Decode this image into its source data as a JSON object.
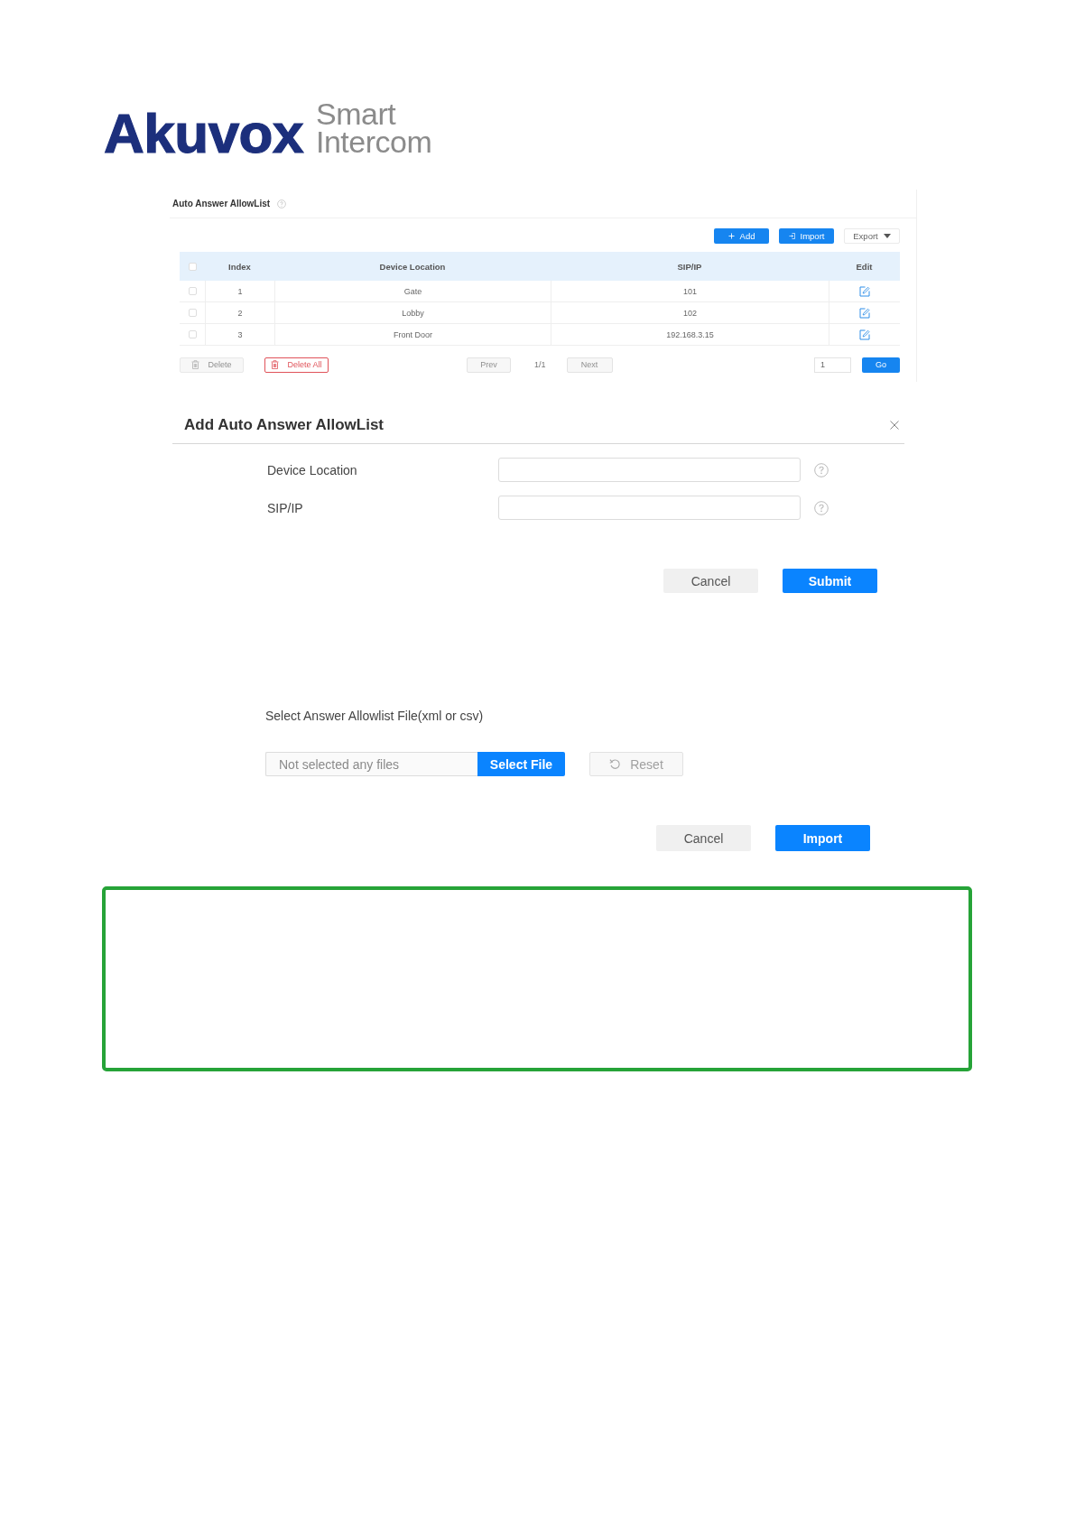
{
  "logo": {
    "brand": "Akuvox",
    "tagline": [
      "Smart",
      "Intercom"
    ]
  },
  "allowlist": {
    "title": "Auto Answer AllowList",
    "actions": [
      {
        "kind": "add",
        "label": "Add"
      },
      {
        "kind": "import",
        "label": "Import"
      },
      {
        "kind": "export",
        "label": "Export"
      }
    ],
    "table": {
      "select_all": {
        "checked": false
      },
      "columns": [
        "Index",
        "Device Location",
        "SIP/IP",
        "Edit"
      ],
      "rows": [
        {
          "checked": false,
          "index": "1",
          "device_location": "Gate",
          "sip_ip": "101"
        },
        {
          "checked": false,
          "index": "2",
          "device_location": "Lobby",
          "sip_ip": "102"
        },
        {
          "checked": false,
          "index": "3",
          "device_location": "Front Door",
          "sip_ip": "192.168.3.15"
        }
      ]
    },
    "footer": {
      "delete": {
        "label": "Delete",
        "disabled": true
      },
      "delete_all": {
        "label": "Delete All",
        "disabled": false
      },
      "prev": {
        "label": "Prev",
        "disabled": true
      },
      "page": "1/1",
      "next": {
        "label": "Next",
        "disabled": true
      },
      "page_input": {
        "value": "1"
      },
      "go": "Go"
    }
  },
  "add_dialog": {
    "title": "Add Auto Answer AllowList",
    "fields": [
      {
        "label": "Device Location"
      },
      {
        "label": "SIP/IP"
      }
    ],
    "buttons": [
      {
        "kind": "secondary",
        "label": "Cancel"
      },
      {
        "kind": "primary",
        "label": "Submit"
      }
    ]
  },
  "import_dialog": {
    "label": "Select Answer Allowlist File(xml or csv)",
    "file_field": {
      "placeholder": "Not selected any files"
    },
    "select_button": "Select File",
    "reset_button": {
      "label": "Reset",
      "disabled": true
    },
    "buttons": [
      {
        "kind": "secondary",
        "label": "Cancel"
      },
      {
        "kind": "primary",
        "label": "Import"
      }
    ]
  }
}
